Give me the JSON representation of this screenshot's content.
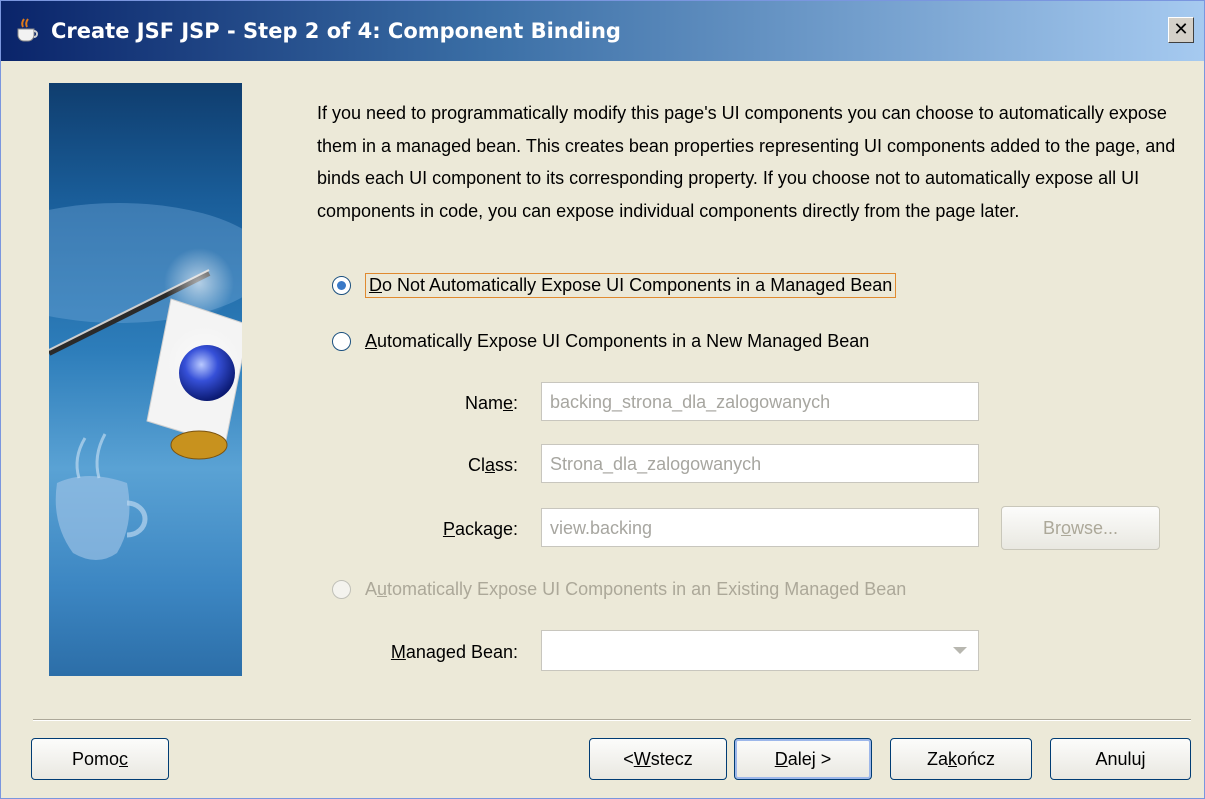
{
  "window": {
    "title": "Create JSF JSP - Step 2 of 4: Component Binding",
    "close_label": "✕"
  },
  "description": "If you need to programmatically modify this page's UI components you can choose to automatically expose them in a managed bean. This creates bean properties representing UI components added to the page, and binds each UI component to its corresponding property. If you choose not to automatically expose all UI components in code, you can expose individual components directly from the page later.",
  "options": {
    "do_not_expose": {
      "mnemonic": "D",
      "rest": "o Not Automatically Expose UI Components in a Managed Bean",
      "selected": true
    },
    "new_bean": {
      "mnemonic": "A",
      "rest": "utomatically Expose UI Components in a New Managed Bean",
      "selected": false
    },
    "existing_bean": {
      "pre": "A",
      "mnemonic": "u",
      "rest": "tomatically Expose UI Components in an Existing Managed Bean",
      "selected": false,
      "enabled": false
    }
  },
  "fields": {
    "name": {
      "label_pre": "Nam",
      "label_mn": "e",
      "label_post": ":",
      "value": "backing_strona_dla_zalogowanych"
    },
    "class": {
      "label_pre": "Cl",
      "label_mn": "a",
      "label_post": "ss:",
      "value": "Strona_dla_zalogowanych"
    },
    "package": {
      "label_pre": "",
      "label_mn": "P",
      "label_post": "ackage:",
      "value": "view.backing"
    },
    "managed_bean": {
      "label_pre": "",
      "label_mn": "M",
      "label_post": "anaged Bean:",
      "value": ""
    }
  },
  "buttons": {
    "browse": {
      "pre": "Br",
      "mn": "o",
      "post": "wse..."
    },
    "help": {
      "pre": "Pomo",
      "mn": "c",
      "post": ""
    },
    "back": {
      "pre": "< ",
      "mn": "W",
      "post": "stecz"
    },
    "next": {
      "pre": "",
      "mn": "D",
      "post": "alej >"
    },
    "finish": {
      "pre": "Za",
      "mn": "k",
      "post": "ończ"
    },
    "cancel": {
      "pre": "Anuluj",
      "mn": "",
      "post": ""
    }
  }
}
